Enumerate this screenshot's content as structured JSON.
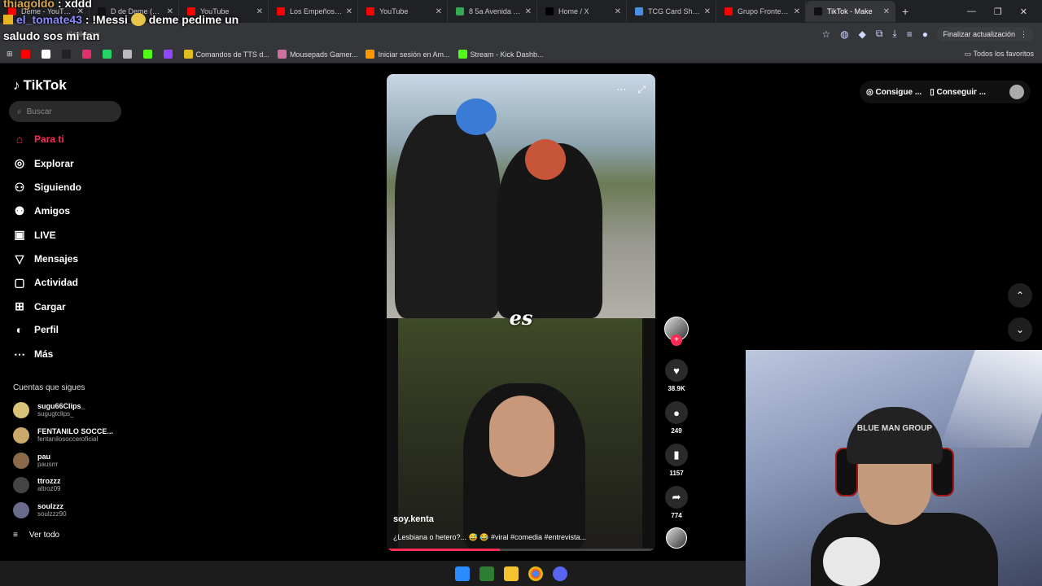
{
  "chat": [
    {
      "user": "thiagoldo",
      "message": " : xddd"
    },
    {
      "user": "el_tomate43",
      "message": " : !Messi",
      "message_cont": " deme pedime un saludo sos mi fan"
    }
  ],
  "browser": {
    "tabs": [
      {
        "label": "Deme - YouTube",
        "color": "#ff0000"
      },
      {
        "label": "D de Deme (@d...",
        "color": "#111111"
      },
      {
        "label": "YouTube",
        "color": "#ff0000"
      },
      {
        "label": "Los Empeños de",
        "color": "#ff0000"
      },
      {
        "label": "YouTube",
        "color": "#ff0000"
      },
      {
        "label": "8 5a Avenida Nor",
        "color": "#34a853"
      },
      {
        "label": "Home / X",
        "color": "#000000"
      },
      {
        "label": "TCG Card Shop Si",
        "color": "#4a90e2"
      },
      {
        "label": "Grupo Frontera, F",
        "color": "#ff0000"
      },
      {
        "label": "TikTok - Make",
        "color": "#111111"
      }
    ],
    "new_tab": "+",
    "url": "tiktok.com",
    "update_button": "Finalizar actualización",
    "bookmarks": [
      {
        "label": "",
        "color": "#ff0000"
      },
      {
        "label": "",
        "color": "#ffffff"
      },
      {
        "label": "",
        "color": "#222222"
      },
      {
        "label": "",
        "color": "#e1306c"
      },
      {
        "label": "",
        "color": "#25d366"
      },
      {
        "label": "",
        "color": "#bbbbbb"
      },
      {
        "label": "",
        "color": "#53fc18"
      },
      {
        "label": "",
        "color": "#9146ff"
      },
      {
        "label": "Comandos de TTS d...",
        "color": "#e0c020"
      },
      {
        "label": "Mousepads Gamer...",
        "color": "#d070a0"
      },
      {
        "label": "Iniciar sesión en Am...",
        "color": "#ff9900"
      },
      {
        "label": "Stream - Kick Dashb...",
        "color": "#53fc18"
      }
    ],
    "all_bookmarks": "Todos los favoritos"
  },
  "tiktok": {
    "logo": "TikTok",
    "search_placeholder": "Buscar",
    "nav": [
      {
        "label": "Para ti",
        "icon": "home-icon",
        "glyph": "⌂"
      },
      {
        "label": "Explorar",
        "icon": "compass-icon",
        "glyph": "◎"
      },
      {
        "label": "Siguiendo",
        "icon": "following-icon",
        "glyph": "⚇"
      },
      {
        "label": "Amigos",
        "icon": "friends-icon",
        "glyph": "⚉"
      },
      {
        "label": "LIVE",
        "icon": "live-icon",
        "glyph": "▣"
      },
      {
        "label": "Mensajes",
        "icon": "messages-icon",
        "glyph": "▽"
      },
      {
        "label": "Actividad",
        "icon": "activity-icon",
        "glyph": "▢"
      },
      {
        "label": "Cargar",
        "icon": "upload-icon",
        "glyph": "⊞"
      },
      {
        "label": "Perfil",
        "icon": "profile-icon",
        "glyph": "◐"
      },
      {
        "label": "Más",
        "icon": "more-icon",
        "glyph": "⋯"
      }
    ],
    "following_header": "Cuentas que sigues",
    "following": [
      {
        "name": "sugu66Clips_",
        "handle": "sugugtclips_",
        "color": "#d9c27a"
      },
      {
        "name": "FENTANILO SOCCE...",
        "handle": "fentanilosocceroficial",
        "color": "#c9a86a"
      },
      {
        "name": "pau",
        "handle": "pausrrr",
        "color": "#8a6a4a"
      },
      {
        "name": "ttrozzz",
        "handle": "altroz09",
        "color": "#444444"
      },
      {
        "name": "soulzzz",
        "handle": "soulzzz90",
        "color": "#6a6a8a"
      }
    ],
    "see_all": "Ver todo",
    "top_actions": {
      "coins": "Consigue ...",
      "app": "Conseguir ..."
    },
    "video": {
      "overlay_word": "es",
      "author": "soy.kenta",
      "description": "¿Lesbiana o hetero?... 😅 😂 #viral #comedia #entrevista...",
      "progress": 0.42
    },
    "actions": {
      "likes": "38.9K",
      "comments": "249",
      "saves": "1157",
      "shares": "774"
    }
  },
  "webcam": {
    "beanie_text": "BLUE MAN GROUP"
  }
}
